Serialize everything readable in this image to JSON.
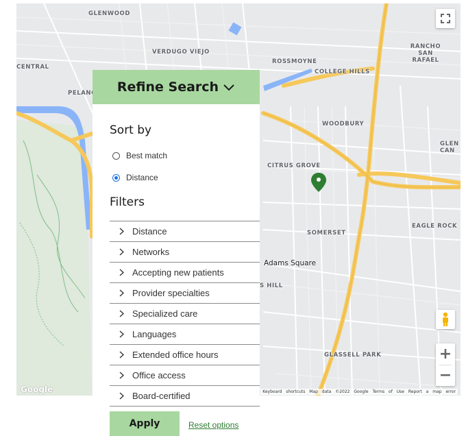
{
  "map": {
    "labels": {
      "glenwood": "GLENWOOD",
      "verdugo_viejo": "VERDUGO VIEJO",
      "rossmoyne": "ROSSMOYNE",
      "rancho_san_rafael": "RANCHO SAN RAFAEL",
      "college_hills": "COLLEGE HILLS",
      "central": "CENTRAL",
      "pelanconi": "PELANC",
      "woodbury": "WOODBURY",
      "glen_can": "GLEN CAN",
      "citrus_grove": "CITRUS GROVE",
      "eagle_rock": "EAGLE ROCK",
      "somerset": "SOMERSET",
      "adams_square": "Adams Square",
      "s_hill": "S HILL",
      "glassell_park": "GLASSELL PARK"
    },
    "attribution": "Keyboard shortcuts  Map data ©2022 Google  Terms of Use  Report a map error",
    "google_logo": "Google",
    "zoom_in": "+",
    "zoom_out": "−",
    "highway_color": "#f6c85a",
    "water_color": "#8ab4f8",
    "marker_color": "#2e7d32"
  },
  "panel": {
    "title": "Refine Search",
    "sort_by": "Sort by",
    "sort_options": [
      {
        "label": "Best match",
        "selected": false
      },
      {
        "label": "Distance",
        "selected": true
      }
    ],
    "filters_title": "Filters",
    "filters": [
      "Distance",
      "Networks",
      "Accepting new patients",
      "Provider specialties",
      "Specialized care",
      "Languages",
      "Extended office hours",
      "Office access",
      "Board-certified"
    ],
    "accent_color": "#a8d8a0"
  },
  "actions": {
    "apply": "Apply",
    "reset": "Reset options"
  }
}
